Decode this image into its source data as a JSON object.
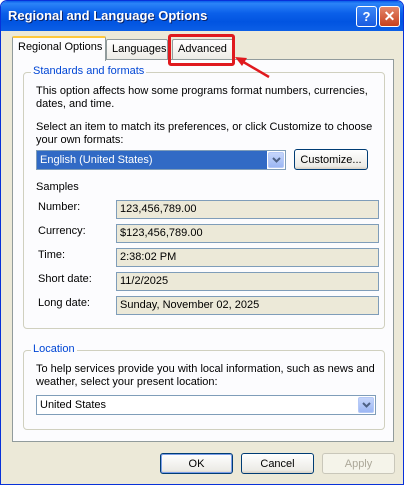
{
  "window": {
    "title": "Regional and Language Options",
    "help_glyph": "?",
    "close_glyph": "✕"
  },
  "tabs": [
    {
      "label": "Regional Options",
      "active": true
    },
    {
      "label": "Languages",
      "active": false
    },
    {
      "label": "Advanced",
      "active": false
    }
  ],
  "standards": {
    "legend": "Standards and formats",
    "description": "This option affects how some programs format numbers, currencies, dates, and time.",
    "instruction": "Select an item to match its preferences, or click Customize to choose your own formats:",
    "selected_format": "English (United States)",
    "customize_label": "Customize...",
    "samples_label": "Samples",
    "samples": [
      {
        "label": "Number:",
        "value": "123,456,789.00"
      },
      {
        "label": "Currency:",
        "value": "$123,456,789.00"
      },
      {
        "label": "Time:",
        "value": "2:38:02 PM"
      },
      {
        "label": "Short date:",
        "value": "11/2/2025"
      },
      {
        "label": "Long date:",
        "value": "Sunday, November 02, 2025"
      }
    ]
  },
  "location": {
    "legend": "Location",
    "description": "To help services provide you with local information, such as news and weather, select your present location:",
    "selected": "United States"
  },
  "footer": {
    "ok_label": "OK",
    "cancel_label": "Cancel",
    "apply_label": "Apply"
  },
  "colors": {
    "title_bar": "#0054e3",
    "highlight": "#e0191e",
    "group_legend": "#0046d5"
  }
}
